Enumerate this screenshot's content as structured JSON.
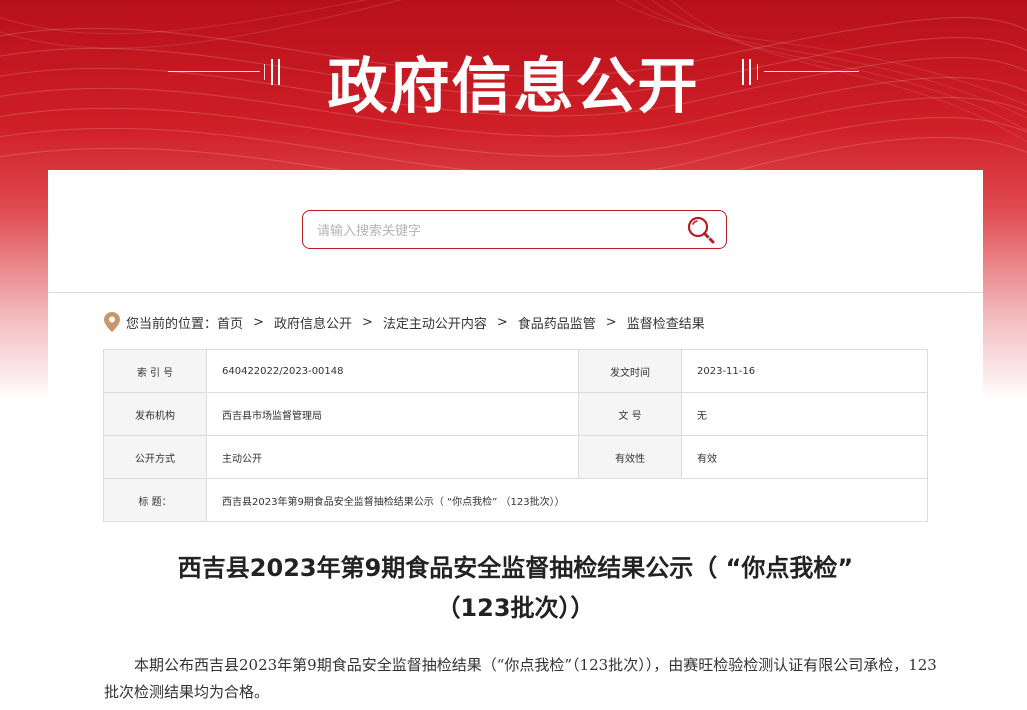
{
  "banner": {
    "title": "政府信息公开"
  },
  "search": {
    "placeholder": "请输入搜索关键字"
  },
  "breadcrumb": {
    "prefix": "您当前的位置：",
    "items": [
      "首页",
      "政府信息公开",
      "法定主动公开内容",
      "食品药品监管",
      "监督检查结果"
    ],
    "separator": ">"
  },
  "meta": {
    "index_label": "索 引 号",
    "index_value": "640422022/2023-00148",
    "date_label": "发文时间",
    "date_value": "2023-11-16",
    "org_label": "发布机构",
    "org_value": "西吉县市场监督管理局",
    "docno_label": "文 号",
    "docno_value": "无",
    "method_label": "公开方式",
    "method_value": "主动公开",
    "validity_label": "有效性",
    "validity_value": "有效",
    "title_label": "标 题：",
    "title_value": "西吉县2023年第9期食品安全监督抽检结果公示（ “你点我检” （123批次））"
  },
  "article": {
    "title_line1": "西吉县2023年第9期食品安全监督抽检结果公示（ “你点我检”",
    "title_line2": "（123批次））",
    "body": "本期公布西吉县2023年第9期食品安全监督抽检结果（“你点我检”（123批次）），由赛旺检验检测认证有限公司承检，123批次检测结果均为合格。"
  },
  "colors": {
    "brand_red": "#c8161d",
    "border": "#dcdcdc",
    "label_bg": "#f5f5f5"
  }
}
